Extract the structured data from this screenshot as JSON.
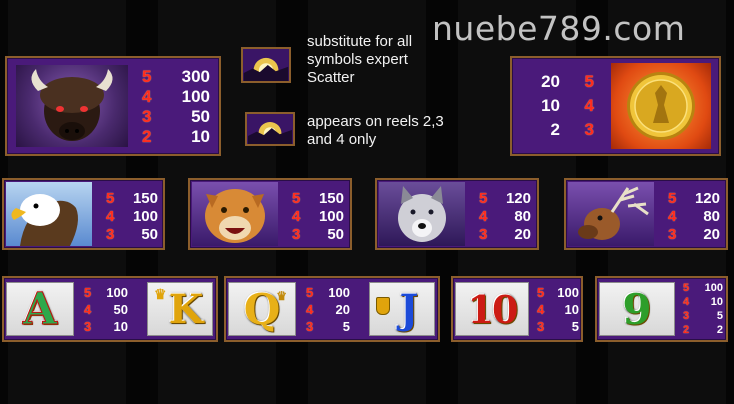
{
  "watermark": "nuebe789.com",
  "notes": {
    "substitute": [
      "substitute for all",
      "symbols expert",
      "Scatter"
    ],
    "reels": [
      "appears on reels 2,3",
      "and 4 only"
    ]
  },
  "buffalo": {
    "counts": [
      "5",
      "4",
      "3",
      "2"
    ],
    "amounts": [
      "300",
      "100",
      "50",
      "10"
    ]
  },
  "coin": {
    "counts": [
      "5",
      "4",
      "3"
    ],
    "amounts": [
      "20",
      "10",
      "2"
    ]
  },
  "eagle": {
    "counts": [
      "5",
      "4",
      "3"
    ],
    "amounts": [
      "150",
      "100",
      "50"
    ]
  },
  "cougar": {
    "counts": [
      "5",
      "4",
      "3"
    ],
    "amounts": [
      "150",
      "100",
      "50"
    ]
  },
  "wolf": {
    "counts": [
      "5",
      "4",
      "3"
    ],
    "amounts": [
      "120",
      "80",
      "20"
    ]
  },
  "elk": {
    "counts": [
      "5",
      "4",
      "3"
    ],
    "amounts": [
      "120",
      "80",
      "20"
    ]
  },
  "ak": {
    "letter_a": "A",
    "letter_k": "K",
    "counts": [
      "5",
      "4",
      "3"
    ],
    "amounts": [
      "100",
      "50",
      "10"
    ]
  },
  "qj": {
    "letter_q": "Q",
    "letter_j": "J",
    "counts": [
      "5",
      "4",
      "3"
    ],
    "amounts": [
      "100",
      "20",
      "5"
    ]
  },
  "ten": {
    "letter": "10",
    "counts": [
      "5",
      "4",
      "3"
    ],
    "amounts": [
      "100",
      "10",
      "5"
    ]
  },
  "nine": {
    "letter": "9",
    "counts": [
      "5",
      "4",
      "3",
      "2"
    ],
    "amounts": [
      "100",
      "10",
      "5",
      "2"
    ]
  },
  "colors": {
    "panel": "#4a1a7a",
    "border": "#8c5e2c",
    "count_red": "#ff2b1e",
    "amount_white": "#ffffff",
    "a_green": "#2ea84b",
    "k_gold": "#e0a40c",
    "q_gold": "#e8b018",
    "j_blue": "#1c4bd8",
    "ten_red": "#cc1b14",
    "nine_green": "#2e9e2a"
  }
}
